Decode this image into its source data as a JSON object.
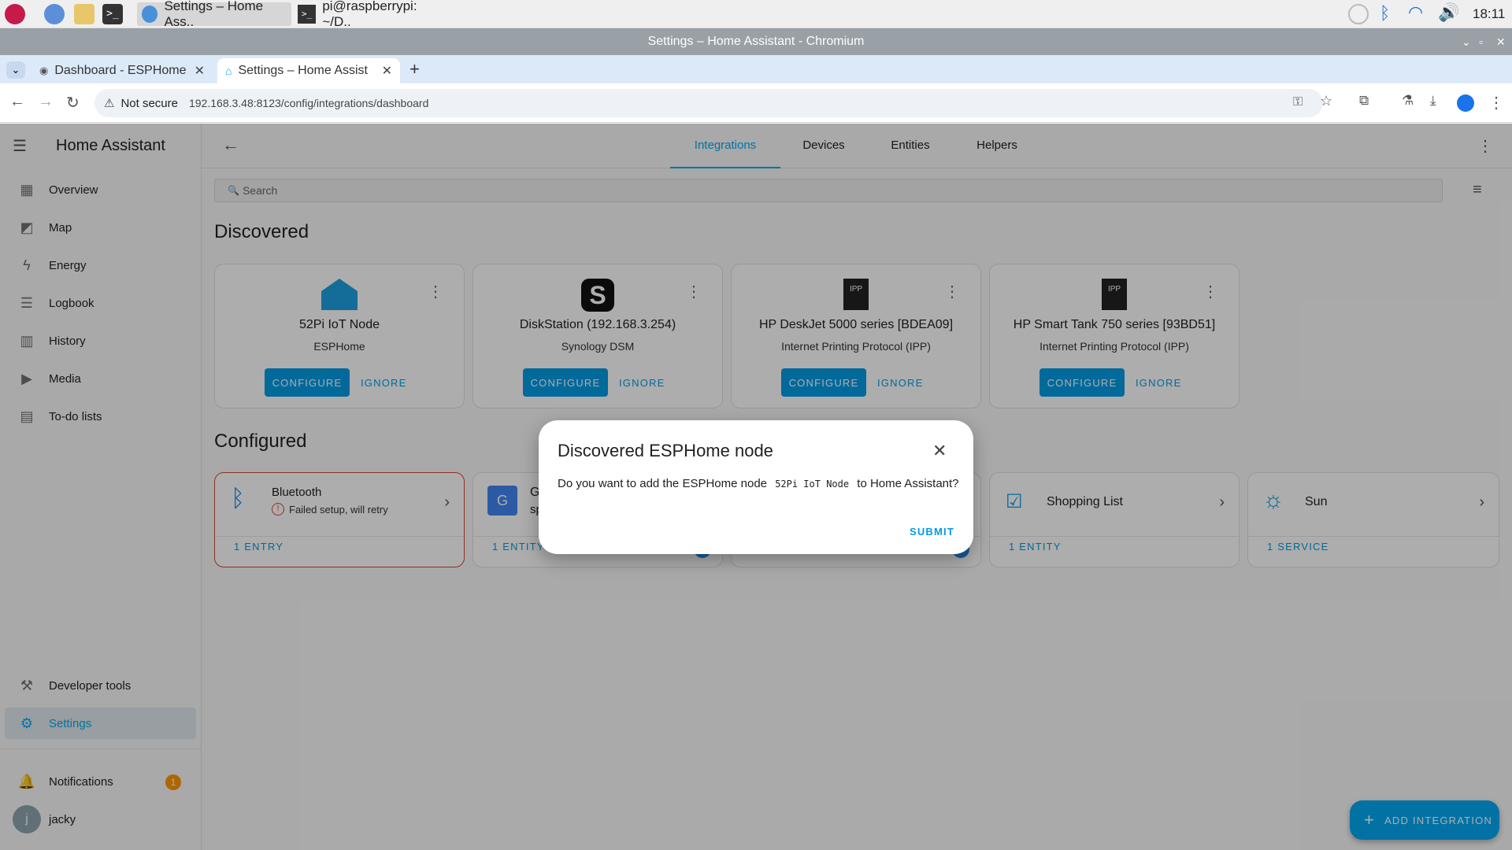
{
  "taskbar": {
    "windows": [
      {
        "label": "Settings – Home Ass.."
      },
      {
        "label": "pi@raspberrypi: ~/D.."
      }
    ],
    "clock": "18:11"
  },
  "window_title": "Settings – Home Assistant - Chromium",
  "browser": {
    "tabs": [
      {
        "label": "Dashboard - ESPHome"
      },
      {
        "label": "Settings – Home Assist"
      }
    ],
    "security_label": "Not secure",
    "url": "192.168.3.48:8123/config/integrations/dashboard"
  },
  "sidebar": {
    "app_title": "Home Assistant",
    "items": [
      {
        "label": "Overview",
        "icon": "dashboard-icon"
      },
      {
        "label": "Map",
        "icon": "map-icon"
      },
      {
        "label": "Energy",
        "icon": "lightning-icon"
      },
      {
        "label": "Logbook",
        "icon": "list-icon"
      },
      {
        "label": "History",
        "icon": "chart-icon"
      },
      {
        "label": "Media",
        "icon": "media-icon"
      },
      {
        "label": "To-do lists",
        "icon": "clipboard-icon"
      }
    ],
    "developer_tools": "Developer tools",
    "settings": "Settings",
    "notifications": "Notifications",
    "notifications_count": "1",
    "user_initial": "j",
    "user_name": "jacky"
  },
  "topbar": {
    "tabs": [
      "Integrations",
      "Devices",
      "Entities",
      "Helpers"
    ],
    "active_tab": "Integrations"
  },
  "search": {
    "placeholder": "Search"
  },
  "discovered": {
    "heading": "Discovered",
    "cards": [
      {
        "title": "52Pi IoT Node",
        "subtitle": "ESPHome",
        "configure": "CONFIGURE",
        "ignore": "IGNORE"
      },
      {
        "title": "DiskStation (192.168.3.254)",
        "subtitle": "Synology DSM",
        "configure": "CONFIGURE",
        "ignore": "IGNORE"
      },
      {
        "title": "HP DeskJet 5000 series [BDEA09]",
        "subtitle": "Internet Printing Protocol (IPP)",
        "configure": "CONFIGURE",
        "ignore": "IGNORE"
      },
      {
        "title": "HP Smart Tank 750 series [93BD51]",
        "subtitle": "Internet Printing Protocol (IPP)",
        "configure": "CONFIGURE",
        "ignore": "IGNORE"
      }
    ]
  },
  "configured": {
    "heading": "Configured",
    "cards": [
      {
        "name": "Bluetooth",
        "status": "Failed setup, will retry",
        "entries": "1 ENTRY"
      },
      {
        "name": "G",
        "sub": "sp",
        "entries": "1 ENTITY"
      },
      {
        "name": "",
        "entries": ""
      },
      {
        "name": "Shopping List",
        "entries": "1 ENTITY"
      },
      {
        "name": "Sun",
        "entries": "1 SERVICE"
      }
    ]
  },
  "dialog": {
    "title": "Discovered ESPHome node",
    "text_before": "Do you want to add the ESPHome node",
    "node_name": "52Pi IoT Node",
    "text_after": "to Home Assistant?",
    "submit": "SUBMIT"
  },
  "fab": {
    "label": "ADD INTEGRATION"
  },
  "colors": {
    "accent": "#03a9f4",
    "button": "#039be5",
    "error": "#db4437",
    "badge": "#ff9800"
  }
}
